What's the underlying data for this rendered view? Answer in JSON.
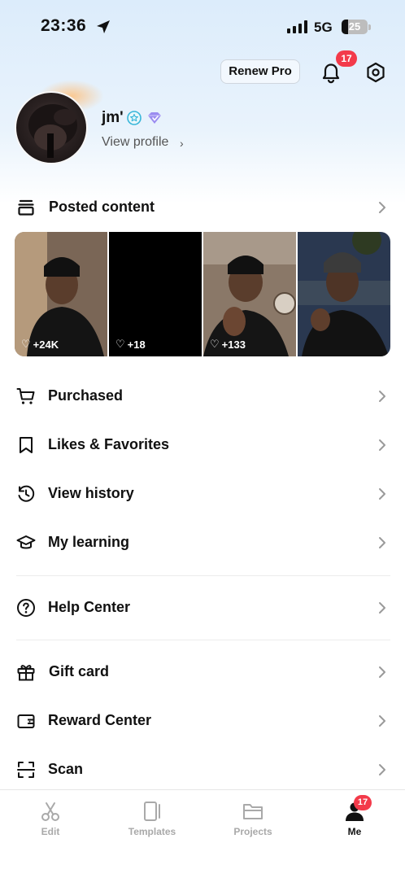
{
  "status_bar": {
    "time": "23:36",
    "network": "5G",
    "battery": "25",
    "battery_level": 0.25
  },
  "header": {
    "renew_label": "Renew Pro",
    "notification_count": "17"
  },
  "profile": {
    "username": "jm'",
    "view_profile_label": "View profile",
    "view_profile_chevron": "›"
  },
  "posted": {
    "label": "Posted content",
    "items": [
      {
        "likes": "+24K"
      },
      {
        "likes": "+18"
      },
      {
        "likes": "+133"
      },
      {
        "likes": ""
      }
    ]
  },
  "menu": [
    {
      "label": "Purchased",
      "icon": "cart-icon"
    },
    {
      "label": "Likes & Favorites",
      "icon": "bookmark-icon"
    },
    {
      "label": "View history",
      "icon": "history-icon"
    },
    {
      "label": "My learning",
      "icon": "graduation-cap-icon"
    },
    {
      "label": "Help Center",
      "icon": "help-icon"
    },
    {
      "label": "Gift card",
      "icon": "gift-icon"
    },
    {
      "label": "Reward Center",
      "icon": "wallet-icon"
    },
    {
      "label": "Scan",
      "icon": "scan-icon"
    }
  ],
  "tabbar": {
    "tabs": [
      {
        "label": "Edit",
        "icon": "scissors-icon"
      },
      {
        "label": "Templates",
        "icon": "templates-icon"
      },
      {
        "label": "Projects",
        "icon": "folder-icon"
      },
      {
        "label": "Me",
        "icon": "person-icon"
      }
    ],
    "me_badge": "17"
  },
  "colors": {
    "accent_red": "#f33a4a",
    "text": "#111111",
    "inactive": "#a9a9a9",
    "header_gradient": "#dcecfb"
  }
}
